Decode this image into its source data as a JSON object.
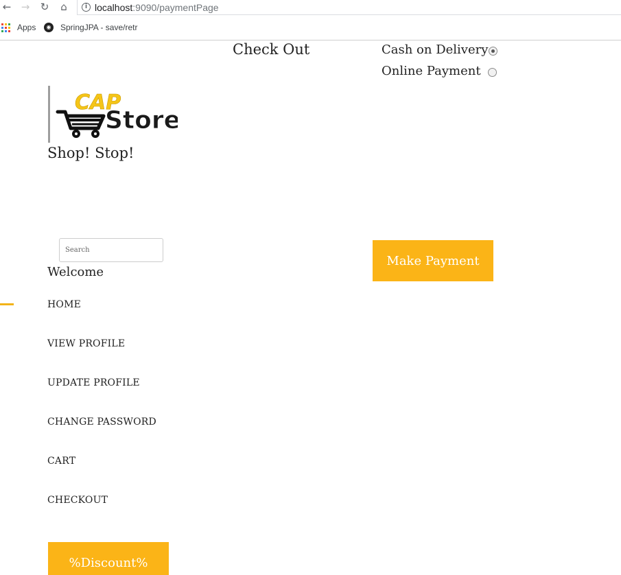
{
  "browser": {
    "url_host": "localhost",
    "url_path": ":9090/paymentPage",
    "bookmarks": [
      {
        "label": "Apps",
        "icon": "apps-grid-icon"
      },
      {
        "label": "SpringJPA - save/retr",
        "icon": "spring-bookmark-icon"
      }
    ]
  },
  "page": {
    "title": "Check Out",
    "tagline": "Shop! Stop!",
    "logo": {
      "text_cap": "CAP",
      "text_store": "Store",
      "accent_color": "#f5c518"
    },
    "payment_options": [
      {
        "label": "Cash on Delivery",
        "selected": true
      },
      {
        "label": "Online Payment",
        "selected": false
      }
    ],
    "search": {
      "placeholder": "Search",
      "value": ""
    },
    "make_payment_label": "Make Payment",
    "welcome": "Welcome",
    "nav": [
      {
        "label": "HOME",
        "active": true
      },
      {
        "label": "VIEW PROFILE"
      },
      {
        "label": "UPDATE PROFILE"
      },
      {
        "label": "CHANGE PASSWORD"
      },
      {
        "label": "CART"
      },
      {
        "label": "CHECKOUT"
      }
    ],
    "discount_label": "%Discount%"
  },
  "colors": {
    "accent": "#fbb417",
    "button_text": "#ffffff"
  }
}
